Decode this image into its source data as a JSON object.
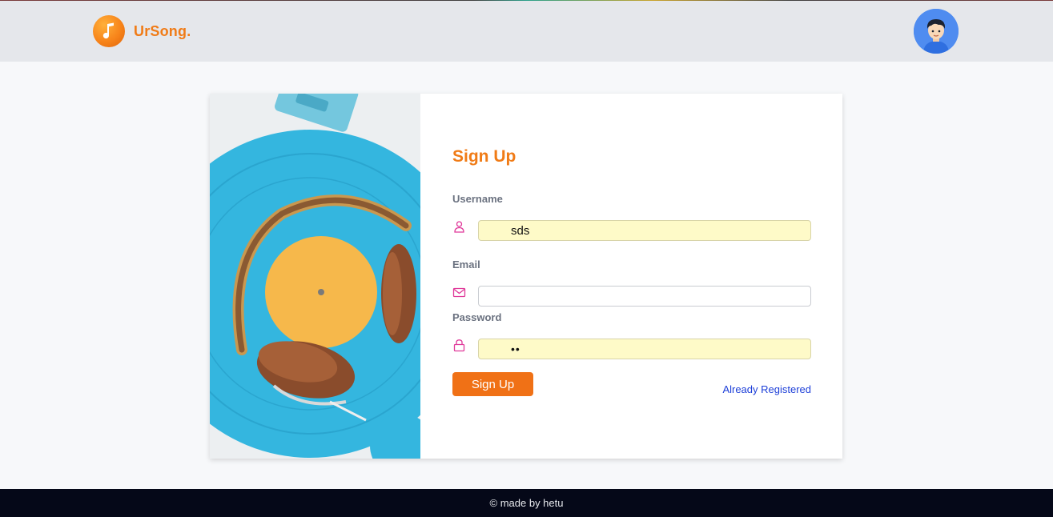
{
  "brand": {
    "name": "UrSong.",
    "logo_icon": "music-note-icon"
  },
  "header": {
    "avatar_icon": "user-avatar-icon"
  },
  "form": {
    "title": "Sign Up",
    "username": {
      "label": "Username",
      "value": "sds",
      "icon": "user-icon"
    },
    "email": {
      "label": "Email",
      "value": "",
      "icon": "mail-icon"
    },
    "password": {
      "label": "Password",
      "value": "••",
      "icon": "lock-icon"
    },
    "submit_label": "Sign Up",
    "login_link": "Already Registered"
  },
  "footer": {
    "text": "© made by hetu"
  },
  "colors": {
    "accent": "#f07116",
    "navbar": "#e5e7eb",
    "footer": "#050818",
    "link": "#1d3fd8",
    "icon": "#e0399a",
    "autofill": "#fefac8"
  }
}
